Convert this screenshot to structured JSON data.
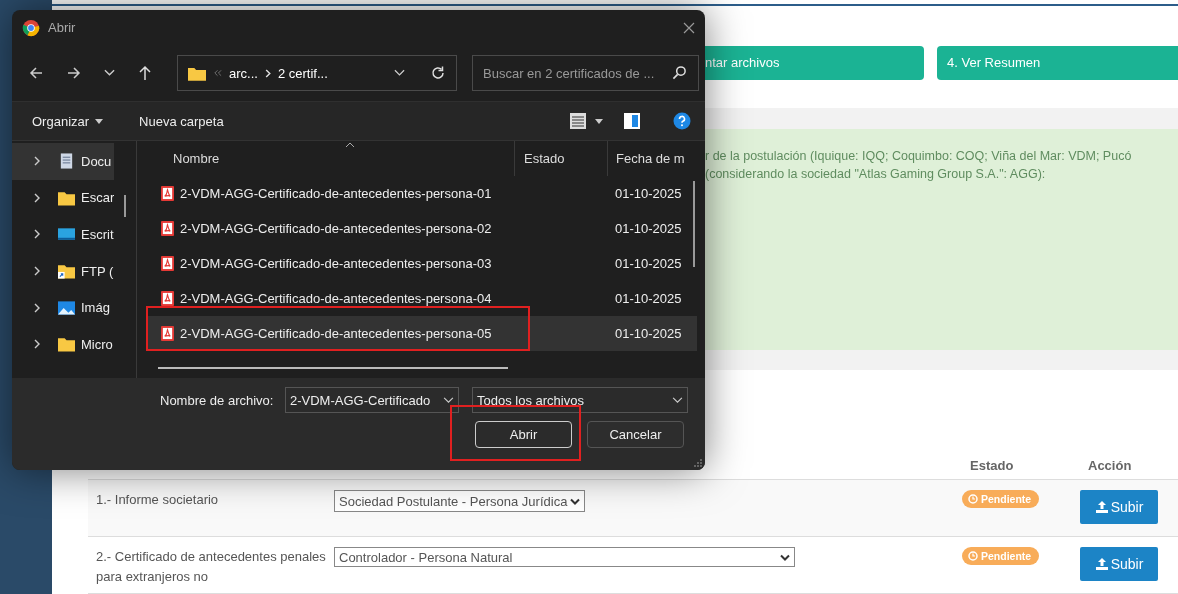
{
  "page": {
    "steps": [
      {
        "label": "ntar archivos"
      },
      {
        "label": "4. Ver Resumen"
      }
    ],
    "notice": {
      "lines": [
        "r de la postulación (Iquique: IQQ; Coquimbo: COQ; Viña del Mar: VDM; Pucó",
        "(considerando la sociedad \"Atlas Gaming Group S.A.\": AGG):"
      ]
    },
    "table": {
      "columns": [
        "Estado",
        "Acción"
      ],
      "rows": [
        {
          "document": "1.- Informe societario",
          "role": "Sociedad Postulante - Persona Jurídica",
          "status": "Pendiente",
          "action": "Subir"
        },
        {
          "document": "2.- Certificado de antecedentes penales para extranjeros no",
          "role": "Controlador - Persona Natural",
          "status": "Pendiente",
          "action": "Subir"
        }
      ]
    }
  },
  "dialog": {
    "title": "Abrir",
    "path": [
      "arc...",
      "2 certif..."
    ],
    "search": {
      "placeholder": "Buscar en 2 certificados de ..."
    },
    "toolbar": {
      "organize": "Organizar",
      "new_folder": "Nueva carpeta"
    },
    "nav": [
      {
        "label": "Docu",
        "kind": "document",
        "selected": true
      },
      {
        "label": "Escar",
        "kind": "folder",
        "selected": false
      },
      {
        "label": "Escrit",
        "kind": "desktop",
        "selected": false
      },
      {
        "label": "FTP (",
        "kind": "ftp",
        "selected": false
      },
      {
        "label": "Imág",
        "kind": "pictures",
        "selected": false
      },
      {
        "label": "Micro",
        "kind": "folder",
        "selected": false
      }
    ],
    "columns": [
      "Nombre",
      "Estado",
      "Fecha de m"
    ],
    "files": [
      {
        "name": "2-VDM-AGG-Certificado-de-antecedentes-persona-01",
        "date": "01-10-2025",
        "selected": false,
        "marked": false
      },
      {
        "name": "2-VDM-AGG-Certificado-de-antecedentes-persona-02",
        "date": "01-10-2025",
        "selected": false,
        "marked": false
      },
      {
        "name": "2-VDM-AGG-Certificado-de-antecedentes-persona-03",
        "date": "01-10-2025",
        "selected": false,
        "marked": false
      },
      {
        "name": "2-VDM-AGG-Certificado-de-antecedentes-persona-04",
        "date": "01-10-2025",
        "selected": false,
        "marked": false
      },
      {
        "name": "2-VDM-AGG-Certificado-de-antecedentes-persona-05",
        "date": "01-10-2025",
        "selected": true,
        "marked": true
      }
    ],
    "filename_label": "Nombre de archivo:",
    "filename": "2-VDM-AGG-Certificado",
    "filetype": "Todos los archivos",
    "buttons": [
      {
        "label": "Abrir",
        "default": true,
        "marked": true
      },
      {
        "label": "Cancelar",
        "default": false,
        "marked": false
      }
    ]
  }
}
